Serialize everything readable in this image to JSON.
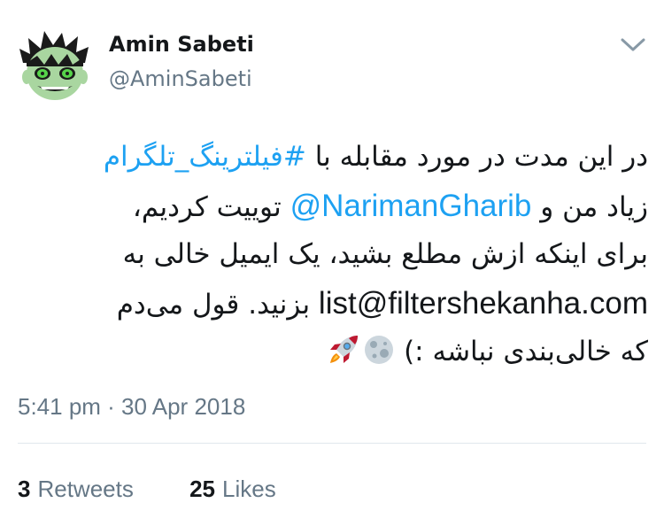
{
  "author": {
    "name": "Amin Sabeti",
    "handle": "@AminSabeti"
  },
  "tweet": {
    "line1_text": "در این مدت در مورد مقابله با ",
    "line1_hashtag": "#فیلترینگ_تلگرام",
    "line2_text_before": "زیاد من و ",
    "line2_mention": "@NarimanGharib",
    "line2_text_after": " توییت کردیم،",
    "line3_text": "برای اینکه ازش مطلع بشید، یک ایمیل خالی به",
    "line4_email": "list@filtershekanha.com",
    "line4_text_after": " بزنید. قول می‌دم",
    "line5_text": "که خالی‌بندی نباشه :) ",
    "emojis": [
      "full-moon-emoji",
      "rocket-emoji"
    ]
  },
  "timestamp": "5:41 pm · 30 Apr 2018",
  "stats": {
    "retweets_count": "3",
    "retweets_label": "Retweets",
    "likes_count": "25",
    "likes_label": "Likes"
  },
  "colors": {
    "link": "#1da1f2",
    "secondary": "#657786",
    "primary": "#14171a",
    "divider": "#e1e8ed"
  }
}
